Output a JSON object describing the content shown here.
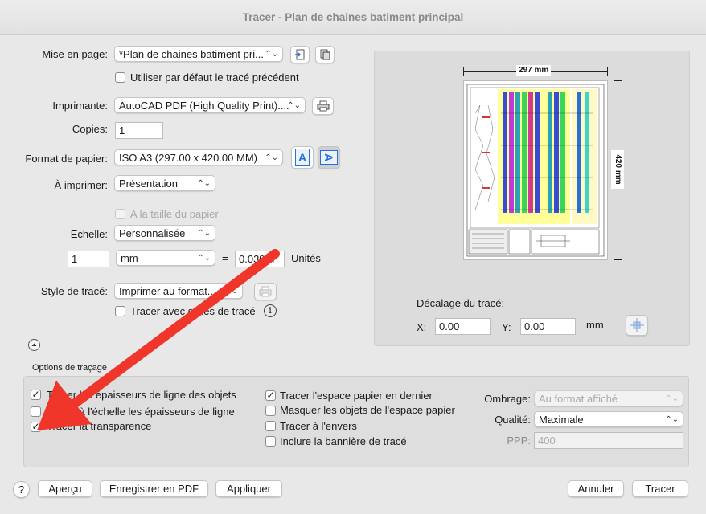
{
  "window": {
    "title": "Tracer - Plan de chaines batiment principal"
  },
  "page_setup": {
    "label": "Mise en page:",
    "value": "*Plan de chaines batiment pri...",
    "use_previous_label": "Utiliser par défaut le tracé précédent",
    "use_previous_checked": false
  },
  "printer": {
    "label": "Imprimante:",
    "value": "AutoCAD PDF (High Quality Print)...."
  },
  "copies": {
    "label": "Copies:",
    "value": "1"
  },
  "paper": {
    "label": "Format de papier:",
    "value": "ISO A3 (297.00 x 420.00 MM)",
    "orientation_portrait": "A",
    "orientation_landscape": "A"
  },
  "what_to_print": {
    "label": "À imprimer:",
    "value": "Présentation"
  },
  "fit_to_paper": {
    "label": "A la taille du papier",
    "checked": false
  },
  "scale": {
    "label": "Echelle:",
    "value": "Personnalisée",
    "numerator": "1",
    "unit": "mm",
    "equals": "=",
    "denominator": "0.03937",
    "units_label": "Unités"
  },
  "plot_style": {
    "label": "Style de tracé:",
    "value": "Imprimer au format...",
    "with_styles_label": "Tracer avec styles de tracé",
    "with_styles_checked": false,
    "info_glyph": "i"
  },
  "preview": {
    "width_label": "297 mm",
    "height_label": "420 mm",
    "offset_title": "Décalage du tracé:",
    "x_label": "X:",
    "x_value": "0.00",
    "y_label": "Y:",
    "y_value": "0.00",
    "unit": "mm"
  },
  "options": {
    "title": "Options de traçage",
    "left": [
      {
        "label": "Tracer les épaisseurs de ligne des objets",
        "checked": true
      },
      {
        "label": "Mettre à l'échelle les épaisseurs de ligne",
        "checked": false
      },
      {
        "label": "Tracer la transparence",
        "checked": true
      }
    ],
    "middle": [
      {
        "label": "Tracer l'espace papier en dernier",
        "checked": true
      },
      {
        "label": "Masquer les objets de l'espace papier",
        "checked": false
      },
      {
        "label": "Tracer à l'envers",
        "checked": false
      },
      {
        "label": "Inclure la bannière de tracé",
        "checked": false
      }
    ],
    "shading_label": "Ombrage:",
    "shading_value": "Au format affiché",
    "quality_label": "Qualité:",
    "quality_value": "Maximale",
    "dpi_label": "PPP:",
    "dpi_value": "400"
  },
  "footer": {
    "help": "?",
    "preview": "Aperçu",
    "save_pdf": "Enregistrer en PDF",
    "apply": "Appliquer",
    "cancel": "Annuler",
    "plot": "Tracer"
  },
  "colors": {
    "arrow": "#f0352a",
    "accent": "#2a6fd6"
  }
}
